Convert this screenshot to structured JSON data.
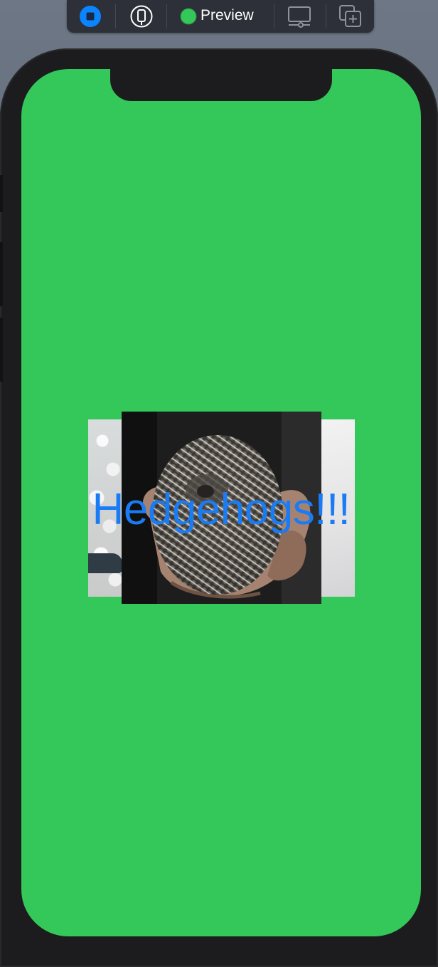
{
  "toolbar": {
    "preview_label": "Preview",
    "icons": [
      "stop-live-icon",
      "device-select-icon",
      "preview-status-dot-icon",
      "device-settings-icon",
      "duplicate-preview-icon"
    ],
    "accent": "#0a84ff",
    "status_color": "#34c759"
  },
  "screen": {
    "background": "#34c759",
    "title_text": "Hedgehogs!!!",
    "title_color": "#1a7cf5",
    "images": [
      "hedgehog-photo-back",
      "hedgehog-photo-front"
    ]
  }
}
